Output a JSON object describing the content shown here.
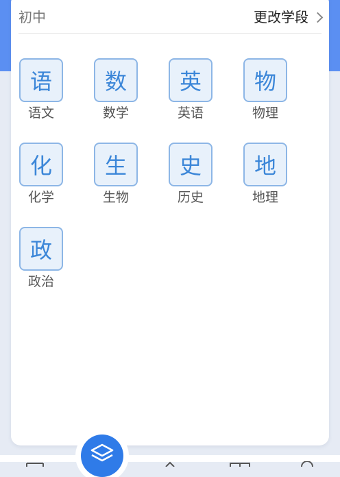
{
  "header": {
    "stage": "初中",
    "change_stage": "更改学段"
  },
  "subjects": [
    {
      "glyph": "语",
      "label": "语文"
    },
    {
      "glyph": "数",
      "label": "数学"
    },
    {
      "glyph": "英",
      "label": "英语"
    },
    {
      "glyph": "物",
      "label": "物理"
    },
    {
      "glyph": "化",
      "label": "化学"
    },
    {
      "glyph": "生",
      "label": "生物"
    },
    {
      "glyph": "史",
      "label": "历史"
    },
    {
      "glyph": "地",
      "label": "地理"
    },
    {
      "glyph": "政",
      "label": "政治"
    }
  ],
  "colors": {
    "accent": "#3b86d8",
    "tile_bg": "#e8f1fb",
    "tile_border": "#8db6e6",
    "fab": "#2f7be8"
  },
  "bottom_nav": {
    "fab_icon": "layers-icon"
  }
}
